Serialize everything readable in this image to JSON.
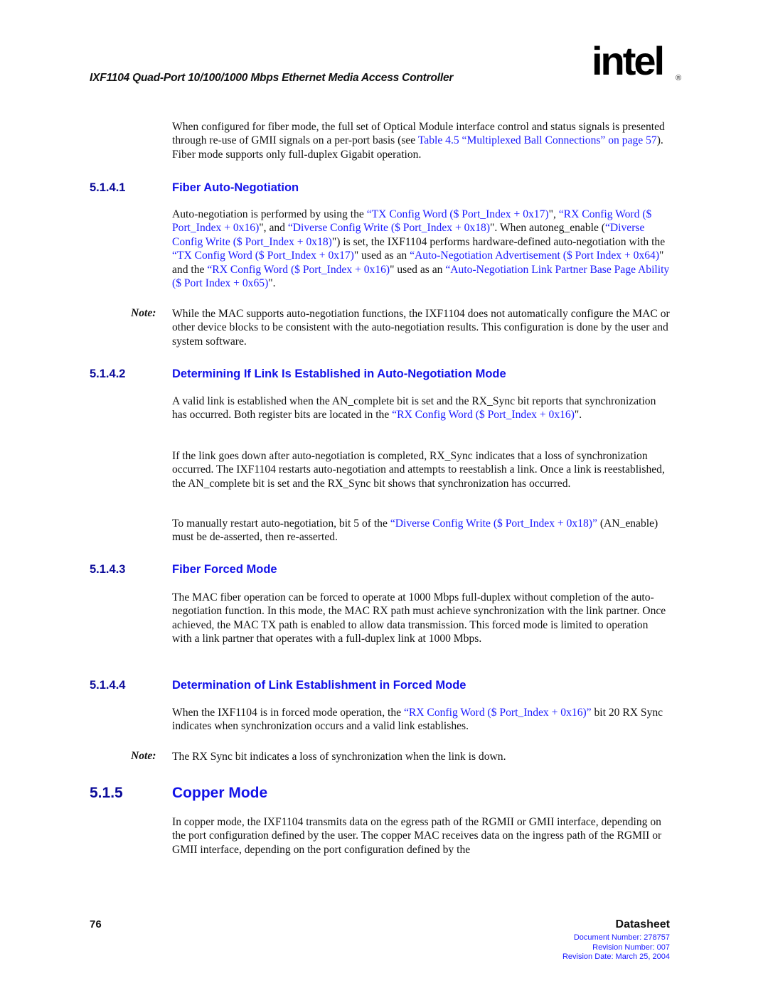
{
  "header": {
    "running_title": "IXF1104 Quad-Port 10/100/1000 Mbps Ethernet Media Access Controller",
    "logo_text": "intel",
    "logo_registered": "®"
  },
  "intro": {
    "text1": "When configured for fiber mode, the full set of Optical Module interface control and status signals is presented through re-use of GMII signals on a per-port basis (see ",
    "link1": "Table 4.5 “Multiplexed Ball Connections” on page 57",
    "text2": "). Fiber mode supports only full-duplex Gigabit operation."
  },
  "s5141": {
    "number": "5.1.4.1",
    "title": "Fiber Auto-Negotiation",
    "p1": {
      "t1": "Auto-negotiation is performed by using the ",
      "l1": "“TX Config Word ($ Port_Index + 0x17)",
      "t2": "\", ",
      "l2": "“RX Config Word ($ Port_Index + 0x16)",
      "t3": "\", and ",
      "l3": "“Diverse Config Write ($ Port_Index + 0x18)",
      "t4": "\". When autoneg_enable (",
      "l4": "“Diverse Config Write ($ Port_Index + 0x18)",
      "t5": "\") is set, the IXF1104 performs hardware-defined auto-negotiation with the ",
      "l5": "“TX Config Word ($ Port_Index + 0x17)",
      "t6": "\" used as an ",
      "l6": "“Auto-Negotiation Advertisement ($ Port Index + 0x64)",
      "t7": "\" and the ",
      "l7": "“RX Config Word ($ Port_Index + 0x16)",
      "t8": "\" used as an ",
      "l8": "“Auto-Negotiation Link Partner Base Page Ability ($ Port Index + 0x65)",
      "t9": "\"."
    },
    "note_label": "Note:",
    "note_text": "While the MAC supports auto-negotiation functions, the IXF1104 does not automatically configure the MAC or other device blocks to be consistent with the auto-negotiation results. This configuration is done by the user and system software."
  },
  "s5142": {
    "number": "5.1.4.2",
    "title": "Determining If Link Is Established in Auto-Negotiation Mode",
    "p1": {
      "t1": "A valid link is established when the AN_complete bit is set and the RX_Sync bit reports that synchronization has occurred. Both register bits are located in the ",
      "l1": "“RX Config Word ($ Port_Index + 0x16)",
      "t2": "\"."
    },
    "p2": "If the link goes down after auto-negotiation is completed, RX_Sync indicates that a loss of synchronization occurred. The IXF1104 restarts auto-negotiation and attempts to reestablish a link. Once a link is reestablished, the AN_complete bit is set and the RX_Sync bit shows that synchronization has occurred.",
    "p3": {
      "t1": "To manually restart auto-negotiation, bit 5 of the ",
      "l1": "“Diverse Config Write ($ Port_Index + 0x18)”",
      "t2": " (AN_enable) must be de-asserted, then re-asserted."
    }
  },
  "s5143": {
    "number": "5.1.4.3",
    "title": "Fiber Forced Mode",
    "p1": "The MAC fiber operation can be forced to operate at 1000 Mbps full-duplex without completion of the auto-negotiation function. In this mode, the MAC RX path must achieve synchronization with the link partner. Once achieved, the MAC TX path is enabled to allow data transmission. This forced mode is limited to operation with a link partner that operates with a full-duplex link at 1000 Mbps."
  },
  "s5144": {
    "number": "5.1.4.4",
    "title": "Determination of Link Establishment in Forced Mode",
    "p1": {
      "t1": "When the IXF1104 is in forced mode operation, the ",
      "l1": "“RX Config Word ($ Port_Index + 0x16)”",
      "t2": " bit 20 RX Sync indicates when synchronization occurs and a valid link establishes."
    },
    "note_label": "Note:",
    "note_text": "The RX Sync bit indicates a loss of synchronization when the link is down."
  },
  "s515": {
    "number": "5.1.5",
    "title": "Copper Mode",
    "p1": "In copper mode, the IXF1104 transmits data on the egress path of the RGMII or GMII interface, depending on the port configuration defined by the user. The copper MAC receives data on the ingress path of the RGMII or GMII interface, depending on the port configuration defined by the"
  },
  "footer": {
    "page_number": "76",
    "doc_type": "Datasheet",
    "document_number": "Document Number: 278757",
    "revision_number": "Revision Number: 007",
    "revision_date": "Revision Date: March 25, 2004"
  }
}
